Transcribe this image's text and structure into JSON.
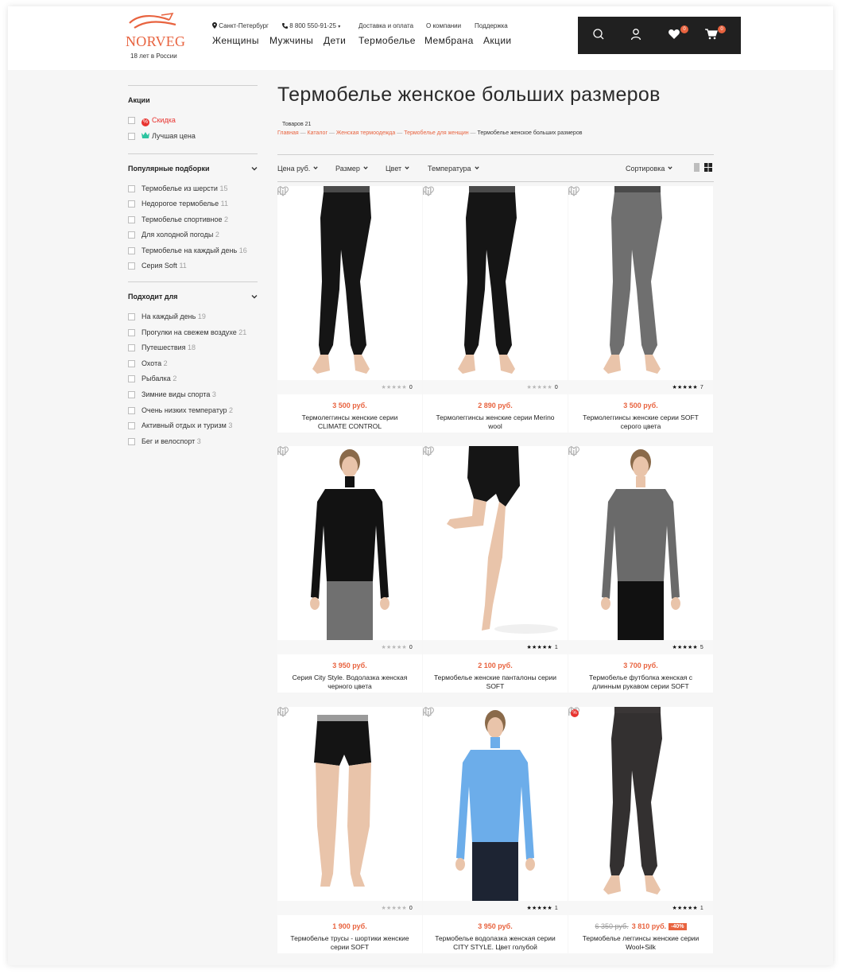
{
  "header": {
    "logo_text": "NORVEG",
    "logo_tagline": "18 лет в России",
    "city": "Санкт-Петербург",
    "phone": "8 800 550-91-25",
    "top_links": [
      "Доставка и оплата",
      "О компании",
      "Поддержка"
    ],
    "main_nav": [
      "Женщины",
      "Мужчины",
      "Дети",
      "Термобелье",
      "Мембрана",
      "Акции"
    ],
    "favorites_count": "0",
    "cart_count": "0"
  },
  "sidebar": {
    "promo": {
      "title": "Акции",
      "items": [
        {
          "label": "Скидка",
          "icon": "percent-icon",
          "color": "#e8332f"
        },
        {
          "label": "Лучшая цена",
          "icon": "crown-icon",
          "color": "#2ec4a0"
        }
      ]
    },
    "popular": {
      "title": "Популярные подборки",
      "items": [
        {
          "label": "Термобелье из шерсти",
          "count": "15"
        },
        {
          "label": "Недорогое термобелье",
          "count": "11"
        },
        {
          "label": "Термобелье спортивное",
          "count": "2"
        },
        {
          "label": "Для холодной погоды",
          "count": "2"
        },
        {
          "label": "Термобелье на каждый день",
          "count": "16"
        },
        {
          "label": "Серия Soft",
          "count": "11"
        }
      ]
    },
    "suitable": {
      "title": "Подходит для",
      "items": [
        {
          "label": "На каждый день",
          "count": "19"
        },
        {
          "label": "Прогулки на свежем воздухе",
          "count": "21"
        },
        {
          "label": "Путешествия",
          "count": "18"
        },
        {
          "label": "Охота",
          "count": "2"
        },
        {
          "label": "Рыбалка",
          "count": "2"
        },
        {
          "label": "Зимние виды спорта",
          "count": "3"
        },
        {
          "label": "Очень низких температур",
          "count": "2"
        },
        {
          "label": "Активный отдых и туризм",
          "count": "3"
        },
        {
          "label": "Бег и велоспорт",
          "count": "3"
        }
      ]
    }
  },
  "content": {
    "title": "Термобелье женское больших размеров",
    "count_text": "Товаров 21",
    "breadcrumbs": [
      "Главная",
      "Каталог",
      "Женская термоодежда",
      "Термобелье для женщин"
    ],
    "breadcrumb_current": "Термобелье женское больших размеров",
    "filters": [
      "Цена руб.",
      "Размер",
      "Цвет",
      "Температура"
    ],
    "sort_label": "Сортировка"
  },
  "products": [
    {
      "price": "3 500 руб.",
      "name": "Термолеггинсы женские серии CLIMATE CONTROL",
      "rating": 0,
      "reviews": "0",
      "image": "black-leggings"
    },
    {
      "price": "2 890 руб.",
      "name": "Термолеггинсы женские серии Merino wool",
      "rating": 0,
      "reviews": "0",
      "image": "black-leggings"
    },
    {
      "price": "3 500 руб.",
      "name": "Термолеггинсы женские серии SOFT серого цвета",
      "rating": 5,
      "reviews": "7",
      "image": "grey-leggings"
    },
    {
      "price": "3 950 руб.",
      "name": "Серия City Style. Водолазка женская черного цвета",
      "rating": 0,
      "reviews": "0",
      "image": "black-turtleneck"
    },
    {
      "price": "2 100 руб.",
      "name": "Термобелье женские панталоны серии SOFT",
      "rating": 5,
      "reviews": "1",
      "image": "black-shorts-leg"
    },
    {
      "price": "3 700 руб.",
      "name": "Термобелье футболка женская с длинным рукавом серии SOFT",
      "rating": 5,
      "reviews": "5",
      "image": "grey-longsleeve"
    },
    {
      "price": "1 900 руб.",
      "name": "Термобелье трусы - шортики женские серии SOFT",
      "rating": 0,
      "reviews": "0",
      "image": "black-boyshorts"
    },
    {
      "price": "3 950 руб.",
      "name": "Термобелье водолазка женская серии CITY STYLE. Цвет голубой",
      "rating": 5,
      "reviews": "1",
      "image": "blue-turtleneck"
    },
    {
      "price": "3 810 руб.",
      "old_price": "6 350 руб.",
      "discount": "-40%",
      "discount_badge": "%",
      "name": "Термобелье леггинсы женские серии Wool+Silk",
      "rating": 5,
      "reviews": "1",
      "image": "dark-leggings"
    }
  ],
  "colors": {
    "accent": "#e8633f",
    "dark": "#202020",
    "sale": "#e8332f",
    "best_price": "#2ec4a0"
  }
}
